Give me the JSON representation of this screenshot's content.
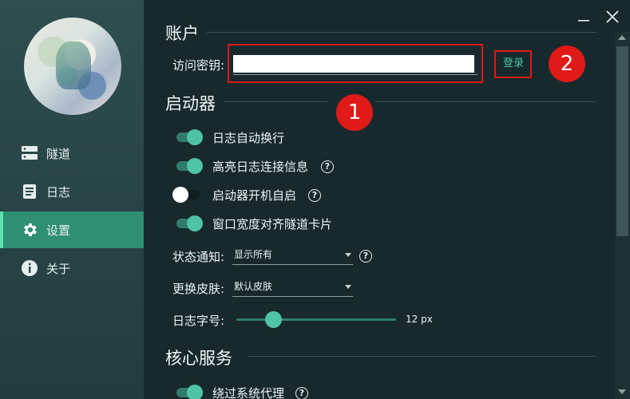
{
  "sidebar": {
    "items": [
      {
        "label": "隧道",
        "icon": "server-icon"
      },
      {
        "label": "日志",
        "icon": "document-icon"
      },
      {
        "label": "设置",
        "icon": "gear-icon",
        "active": true
      },
      {
        "label": "关于",
        "icon": "info-icon"
      }
    ]
  },
  "account": {
    "title": "账户",
    "key_label": "访问密钥:",
    "key_value": "",
    "login_label": "登录"
  },
  "launcher": {
    "title": "启动器",
    "options": [
      {
        "label": "日志自动换行",
        "on": true
      },
      {
        "label": "高亮日志连接信息",
        "on": true
      },
      {
        "label": "启动器开机自启",
        "on": false
      },
      {
        "label": "窗口宽度对齐隧道卡片",
        "on": true
      }
    ],
    "notify_label": "状态通知:",
    "notify_value": "显示所有",
    "skin_label": "更换皮肤:",
    "skin_value": "默认皮肤",
    "fontsize_label": "日志字号:",
    "fontsize_value": "12 px",
    "fontsize_level": 0.23
  },
  "core": {
    "title": "核心服务",
    "options": [
      {
        "label": "绕过系统代理",
        "on": true
      }
    ]
  },
  "annotations": {
    "one": "1",
    "two": "2"
  },
  "colors": {
    "accent": "#4fc4a5",
    "sidebar_active": "#2f8f73",
    "highlight_box": "#e01919",
    "background": "#17292c"
  }
}
